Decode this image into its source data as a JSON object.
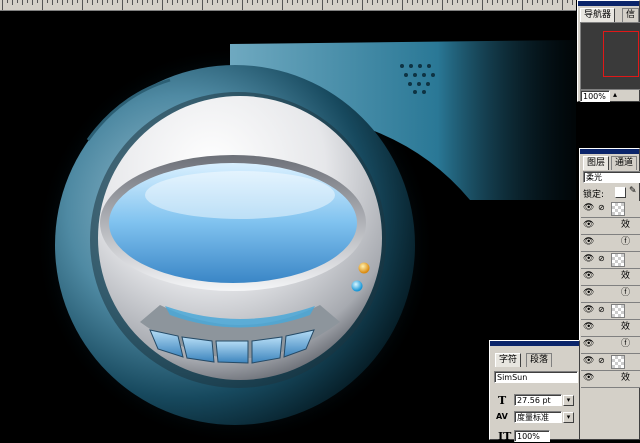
{
  "navigator_panel": {
    "tabs": [
      "导航器",
      "信"
    ],
    "zoom": "100%"
  },
  "layers_panel": {
    "tabs": [
      "图层",
      "通道"
    ],
    "blend_mode": "柔光",
    "lock_label": "锁定:",
    "rows": [
      {
        "kind": "layer",
        "label": ""
      },
      {
        "kind": "effect",
        "label": "效"
      },
      {
        "kind": "effect-icon",
        "label": ""
      },
      {
        "kind": "layer",
        "label": ""
      },
      {
        "kind": "effect",
        "label": "效"
      },
      {
        "kind": "effect-icon",
        "label": ""
      },
      {
        "kind": "layer",
        "label": ""
      },
      {
        "kind": "effect",
        "label": "效"
      },
      {
        "kind": "effect-icon",
        "label": ""
      },
      {
        "kind": "layer",
        "label": ""
      },
      {
        "kind": "effect",
        "label": "效"
      }
    ]
  },
  "character_panel": {
    "tabs": [
      "字符",
      "段落"
    ],
    "font_family": "SimSun",
    "font_size": "27.56 pt",
    "kerning": "度量标准",
    "scale": "100%"
  },
  "colors": {
    "panel_bg": "#d4d0c8",
    "titlebar": "#0a246a",
    "canvas_bg": "#000000",
    "accent_blue": "#2a8fb8"
  }
}
